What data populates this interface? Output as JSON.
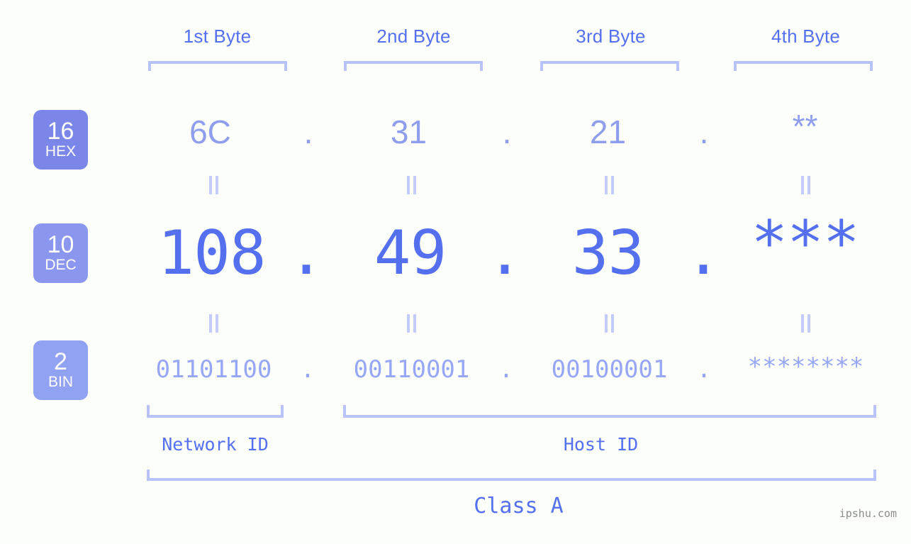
{
  "background_color": "#fcfefa",
  "colors": {
    "header_text": "#5570ef",
    "hex_text": "#8f9ded",
    "dec_text": "#5570ef",
    "bin_text": "#97a6f5",
    "bracket": "#b9c3fb",
    "badge_hex": "#7b87e8",
    "badge_dec": "#8b97ee",
    "badge_bin": "#92a2f2",
    "connector": "#c3ccfc",
    "watermark": "#8d8d8d"
  },
  "byte_headers": [
    {
      "label": "1st Byte"
    },
    {
      "label": "2nd Byte"
    },
    {
      "label": "3rd Byte"
    },
    {
      "label": "4th Byte"
    }
  ],
  "rows": {
    "hex": {
      "badge_number": "16",
      "badge_name": "HEX",
      "values": [
        "6C",
        "31",
        "21",
        "**"
      ],
      "separator": "."
    },
    "dec": {
      "badge_number": "10",
      "badge_name": "DEC",
      "values": [
        "108",
        "49",
        "33",
        "***"
      ],
      "separator": "."
    },
    "bin": {
      "badge_number": "2",
      "badge_name": "BIN",
      "values": [
        "01101100",
        "00110001",
        "00100001",
        "********"
      ],
      "separator": "."
    }
  },
  "id_sections": {
    "network_id": "Network ID",
    "host_id": "Host ID"
  },
  "class_label": "Class A",
  "watermark": "ipshu.com"
}
